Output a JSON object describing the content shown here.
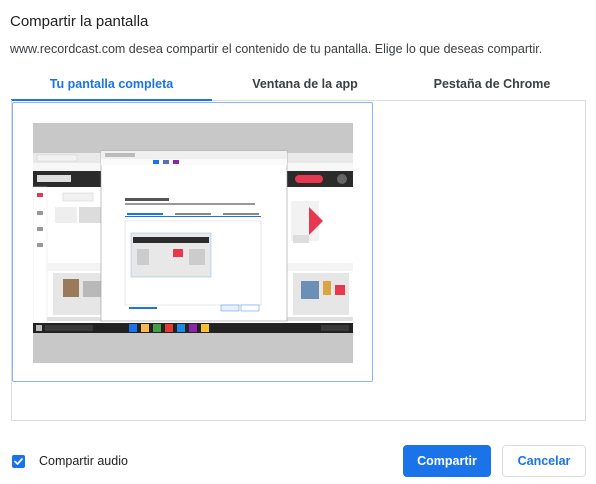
{
  "dialog": {
    "title": "Compartir la pantalla",
    "subtitle": "www.recordcast.com desea compartir el contenido de tu pantalla. Elige lo que deseas compartir."
  },
  "tabs": [
    {
      "label": "Tu pantalla completa",
      "active": true
    },
    {
      "label": "Ventana de la app",
      "active": false
    },
    {
      "label": "Pestaña de Chrome",
      "active": false
    }
  ],
  "audio": {
    "label": "Compartir audio",
    "checked": true
  },
  "buttons": {
    "share": "Compartir",
    "cancel": "Cancelar"
  },
  "colors": {
    "accent": "#1a73e8",
    "border": "#dadce0",
    "tile_border": "#8ab4f8"
  }
}
